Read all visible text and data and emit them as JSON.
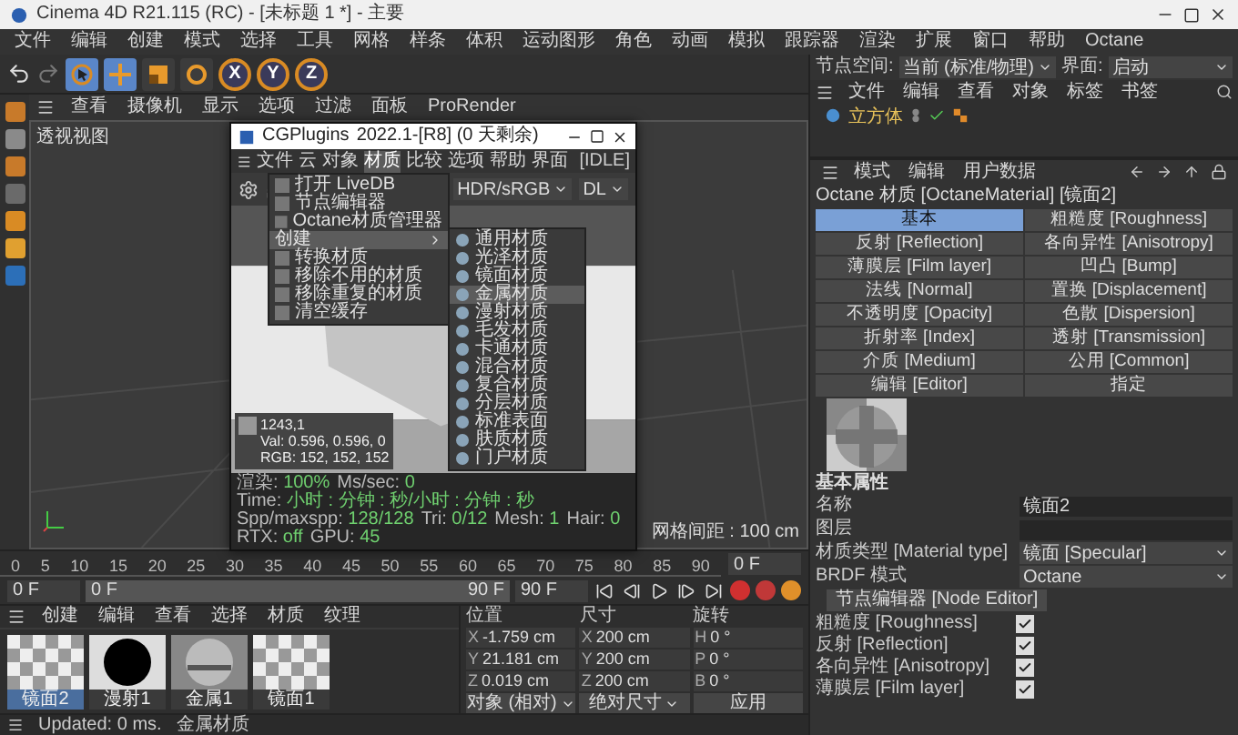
{
  "app_window": {
    "title": "Cinema 4D R21.115 (RC) - [未标题 1 *] - 主要"
  },
  "menu": [
    "文件",
    "编辑",
    "创建",
    "模式",
    "选择",
    "工具",
    "网格",
    "样条",
    "体积",
    "运动图形",
    "角色",
    "动画",
    "模拟",
    "跟踪器",
    "渲染",
    "扩展",
    "窗口",
    "帮助",
    "Octane"
  ],
  "tools": [
    {
      "kind": "select",
      "selected": true
    },
    {
      "kind": "move",
      "selected": true
    },
    {
      "kind": "scale",
      "selected": false
    },
    {
      "kind": "rotate",
      "selected": false
    }
  ],
  "axes": [
    "X",
    "Y",
    "Z"
  ],
  "viewport": {
    "menu": [
      "查看",
      "摄像机",
      "显示",
      "选项",
      "过滤",
      "面板",
      "ProRender"
    ],
    "title": "透视视图",
    "grid_info": "网格间距 : 100 cm"
  },
  "octane": {
    "title": "CGPlugins",
    "version": "2022.1-[R8] (0 天剩余)",
    "menu": [
      {
        "label": "文件",
        "selected": false
      },
      {
        "label": "云",
        "selected": false
      },
      {
        "label": "对象",
        "selected": false
      },
      {
        "label": "材质",
        "selected": true
      },
      {
        "label": "比较",
        "selected": false
      },
      {
        "label": "选项",
        "selected": false
      },
      {
        "label": "帮助",
        "selected": false
      },
      {
        "label": "界面",
        "selected": false
      }
    ],
    "state": "[IDLE]",
    "tonemap": "HDR/sRGB",
    "kernel": "DL",
    "dropdown": [
      {
        "label": "打开 LiveDB",
        "kind": "item",
        "selected": false
      },
      {
        "label": "节点编辑器",
        "kind": "item",
        "selected": false
      },
      {
        "label": "Octane材质管理器",
        "kind": "item",
        "selected": false
      },
      {
        "label": "创建",
        "kind": "submenu",
        "selected": true
      },
      {
        "label": "转换材质",
        "kind": "item",
        "selected": false
      },
      {
        "label": "移除不用的材质",
        "kind": "item",
        "selected": false
      },
      {
        "label": "移除重复的材质",
        "kind": "item",
        "selected": false
      },
      {
        "label": "清空缓存",
        "kind": "item",
        "selected": false
      }
    ],
    "submenu": [
      {
        "label": "通用材质",
        "selected": false
      },
      {
        "label": "光泽材质",
        "selected": false
      },
      {
        "label": "镜面材质",
        "selected": false
      },
      {
        "label": "金属材质",
        "selected": true
      },
      {
        "label": "漫射材质",
        "selected": false
      },
      {
        "label": "毛发材质",
        "selected": false
      },
      {
        "label": "卡通材质",
        "selected": false
      },
      {
        "label": "混合材质",
        "selected": false
      },
      {
        "label": "复合材质",
        "selected": false
      },
      {
        "label": "分层材质",
        "selected": false
      },
      {
        "label": "标准表面",
        "selected": false
      },
      {
        "label": "肤质材质",
        "selected": false
      },
      {
        "label": "门户材质",
        "selected": false
      }
    ],
    "pixel_info": [
      "1243,1",
      "Val: 0.596, 0.596, 0",
      "RGB: 152, 152, 152"
    ],
    "stats": [
      {
        "label": "渲染:",
        "value": "100%"
      },
      {
        "label": "Ms/sec:",
        "value": "0"
      },
      {
        "label": "Time:",
        "value": "小时 : 分钟 : 秒/小时 : 分钟 : 秒"
      },
      {
        "label": "Spp/maxspp:",
        "value": "128/128"
      },
      {
        "label": "Tri:",
        "value": "0/12"
      },
      {
        "label": "Mesh:",
        "value": "1"
      },
      {
        "label": "Hair:",
        "value": "0"
      },
      {
        "label": "RTX:",
        "value": "off"
      },
      {
        "label": "GPU:",
        "value": "45"
      }
    ]
  },
  "node_space": {
    "label": "节点空间:",
    "value": "当前 (标准/物理)",
    "layout_label": "界面:",
    "layout_value": "启动"
  },
  "object_manager": {
    "menu": [
      "文件",
      "编辑",
      "查看",
      "对象",
      "标签",
      "书签"
    ],
    "objects": [
      {
        "name": "立方体"
      }
    ]
  },
  "attributes": {
    "menu": [
      "模式",
      "编辑",
      "用户数据"
    ],
    "title": "Octane 材质 [OctaneMaterial] [镜面2]",
    "tabs": [
      {
        "label": "基本",
        "selected": true
      },
      {
        "label": "粗糙度 [Roughness]",
        "selected": false
      },
      {
        "label": "反射 [Reflection]",
        "selected": false
      },
      {
        "label": "各向异性 [Anisotropy]",
        "selected": false
      },
      {
        "label": "薄膜层 [Film layer]",
        "selected": false
      },
      {
        "label": "凹凸 [Bump]",
        "selected": false
      },
      {
        "label": "法线 [Normal]",
        "selected": false
      },
      {
        "label": "置换 [Displacement]",
        "selected": false
      },
      {
        "label": "不透明度 [Opacity]",
        "selected": false
      },
      {
        "label": "色散 [Dispersion]",
        "selected": false
      },
      {
        "label": "折射率 [Index]",
        "selected": false
      },
      {
        "label": "透射 [Transmission]",
        "selected": false
      },
      {
        "label": "介质 [Medium]",
        "selected": false
      },
      {
        "label": "公用 [Common]",
        "selected": false
      },
      {
        "label": "编辑 [Editor]",
        "selected": false
      },
      {
        "label": "指定",
        "selected": false
      }
    ],
    "section": "基本属性",
    "fields": [
      {
        "kind": "text",
        "label": "名称",
        "value": "镜面2"
      },
      {
        "kind": "layer",
        "label": "图层"
      },
      {
        "kind": "select",
        "label": "材质类型 [Material type]",
        "value": "镜面 [Specular]"
      },
      {
        "kind": "select",
        "label": "BRDF 模式",
        "value": "Octane"
      }
    ],
    "node_editor": "节点编辑器 [Node Editor]",
    "toggles": [
      {
        "label": "粗糙度 [Roughness]",
        "checked": true
      },
      {
        "label": "反射 [Reflection]",
        "checked": true
      },
      {
        "label": "各向异性 [Anisotropy]",
        "checked": true
      },
      {
        "label": "薄膜层 [Film layer]",
        "checked": true
      }
    ]
  },
  "timeline": {
    "ticks": [
      "0",
      "5",
      "10",
      "15",
      "20",
      "25",
      "30",
      "35",
      "40",
      "45",
      "50",
      "55",
      "60",
      "65",
      "70",
      "75",
      "80",
      "85",
      "90"
    ],
    "ruler_field": "0 F",
    "current": "0 F",
    "range": {
      "start": "0 F",
      "end": "90 F",
      "level": 1
    },
    "end": "90 F"
  },
  "material_manager": {
    "menu": [
      "创建",
      "编辑",
      "查看",
      "选择",
      "材质",
      "纹理"
    ],
    "materials": [
      {
        "name": "镜面2",
        "kind": "checker",
        "selected": true
      },
      {
        "name": "漫射1",
        "kind": "black",
        "selected": false
      },
      {
        "name": "金属1",
        "kind": "metal",
        "selected": false
      },
      {
        "name": "镜面1",
        "kind": "checker",
        "selected": false
      }
    ]
  },
  "coordinates": {
    "headers": [
      "位置",
      "尺寸",
      "旋转"
    ],
    "rows": [
      {
        "axis": "X",
        "position": "-1.759 cm",
        "size_axis": "X",
        "size": "200 cm",
        "rot_axis": "H",
        "rotation": "0 °"
      },
      {
        "axis": "Y",
        "position": "21.181 cm",
        "size_axis": "Y",
        "size": "200 cm",
        "rot_axis": "P",
        "rotation": "0 °"
      },
      {
        "axis": "Z",
        "position": "0.019 cm",
        "size_axis": "Z",
        "size": "200 cm",
        "rot_axis": "B",
        "rotation": "0 °"
      }
    ],
    "mode": "对象 (相对)",
    "size_mode": "绝对尺寸",
    "apply": "应用"
  },
  "status_bar": {
    "text": "Updated: 0 ms.",
    "message": "金属材质"
  }
}
